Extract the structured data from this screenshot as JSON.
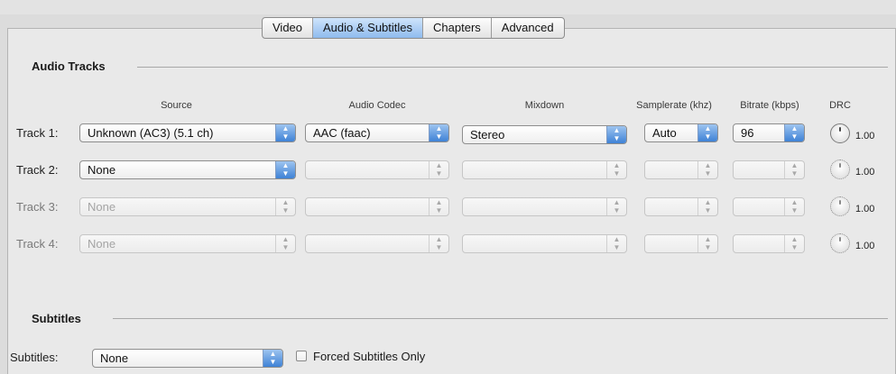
{
  "tabs": [
    {
      "label": "Video",
      "active": false
    },
    {
      "label": "Audio & Subtitles",
      "active": true
    },
    {
      "label": "Chapters",
      "active": false
    },
    {
      "label": "Advanced",
      "active": false
    }
  ],
  "audio": {
    "section_title": "Audio Tracks",
    "columns": {
      "source": "Source",
      "codec": "Audio Codec",
      "mixdown": "Mixdown",
      "samplerate": "Samplerate (khz)",
      "bitrate": "Bitrate (kbps)",
      "drc": "DRC"
    },
    "tracks": [
      {
        "label": "Track 1:",
        "source": "Unknown (AC3) (5.1 ch)",
        "codec": "AAC (faac)",
        "mixdown": "Stereo",
        "samplerate": "Auto",
        "bitrate": "96",
        "drc": "1.00",
        "enabled": true
      },
      {
        "label": "Track 2:",
        "source": "None",
        "codec": "",
        "mixdown": "",
        "samplerate": "",
        "bitrate": "",
        "drc": "1.00",
        "enabled": false
      },
      {
        "label": "Track 3:",
        "source": "None",
        "codec": "",
        "mixdown": "",
        "samplerate": "",
        "bitrate": "",
        "drc": "1.00",
        "enabled": false
      },
      {
        "label": "Track 4:",
        "source": "None",
        "codec": "",
        "mixdown": "",
        "samplerate": "",
        "bitrate": "",
        "drc": "1.00",
        "enabled": false
      }
    ]
  },
  "subtitles": {
    "section_title": "Subtitles",
    "label": "Subtitles:",
    "value": "None",
    "forced_label": "Forced Subtitles Only",
    "forced_checked": false
  },
  "colors": {
    "accent": "#5b9be6",
    "panel": "#e9e9e9",
    "background": "#dcdcdc"
  }
}
